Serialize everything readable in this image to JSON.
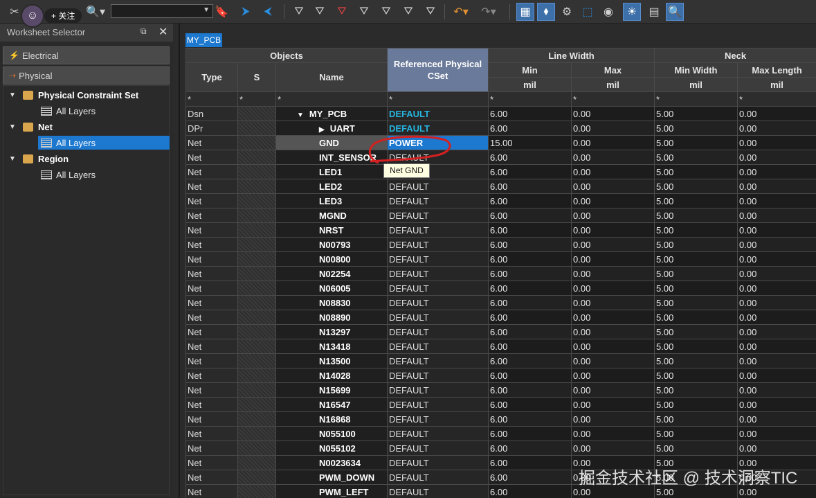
{
  "overlay": {
    "follow_label": "+ 关注",
    "watermark": "掘金技术社区 @ 技术洞察TIC"
  },
  "worksheet_selector": {
    "title": "Worksheet Selector",
    "buttons": [
      "Electrical",
      "Physical"
    ],
    "tree": [
      {
        "label": "Physical Constraint Set",
        "child": "All Layers"
      },
      {
        "label": "Net",
        "child": "All Layers"
      },
      {
        "label": "Region",
        "child": "All Layers"
      }
    ]
  },
  "tab": {
    "label": "MY_PCB"
  },
  "grid": {
    "group_headers": {
      "objects": "Objects",
      "line_width": "Line Width",
      "neck": "Neck"
    },
    "columns": {
      "type": "Type",
      "s": "S",
      "name": "Name",
      "ref": "Referenced Physical CSet",
      "min": "Min",
      "max": "Max",
      "min_width": "Min Width",
      "max_length": "Max Length"
    },
    "unit": "mil",
    "filter": "*",
    "rows": [
      [
        "Dsn",
        "MY_PCB",
        "DEFAULT",
        "6.00",
        "0.00",
        "5.00",
        "0.00"
      ],
      [
        "DPr",
        "UART",
        "DEFAULT",
        "6.00",
        "0.00",
        "5.00",
        "0.00"
      ],
      [
        "Net",
        "GND",
        "POWER",
        "15.00",
        "0.00",
        "5.00",
        "0.00"
      ],
      [
        "Net",
        "INT_SENSOR",
        "DEFAULT",
        "6.00",
        "0.00",
        "5.00",
        "0.00"
      ],
      [
        "Net",
        "LED1",
        "DEFAULT",
        "6.00",
        "0.00",
        "5.00",
        "0.00"
      ],
      [
        "Net",
        "LED2",
        "DEFAULT",
        "6.00",
        "0.00",
        "5.00",
        "0.00"
      ],
      [
        "Net",
        "LED3",
        "DEFAULT",
        "6.00",
        "0.00",
        "5.00",
        "0.00"
      ],
      [
        "Net",
        "MGND",
        "DEFAULT",
        "6.00",
        "0.00",
        "5.00",
        "0.00"
      ],
      [
        "Net",
        "NRST",
        "DEFAULT",
        "6.00",
        "0.00",
        "5.00",
        "0.00"
      ],
      [
        "Net",
        "N00793",
        "DEFAULT",
        "6.00",
        "0.00",
        "5.00",
        "0.00"
      ],
      [
        "Net",
        "N00800",
        "DEFAULT",
        "6.00",
        "0.00",
        "5.00",
        "0.00"
      ],
      [
        "Net",
        "N02254",
        "DEFAULT",
        "6.00",
        "0.00",
        "5.00",
        "0.00"
      ],
      [
        "Net",
        "N06005",
        "DEFAULT",
        "6.00",
        "0.00",
        "5.00",
        "0.00"
      ],
      [
        "Net",
        "N08830",
        "DEFAULT",
        "6.00",
        "0.00",
        "5.00",
        "0.00"
      ],
      [
        "Net",
        "N08890",
        "DEFAULT",
        "6.00",
        "0.00",
        "5.00",
        "0.00"
      ],
      [
        "Net",
        "N13297",
        "DEFAULT",
        "6.00",
        "0.00",
        "5.00",
        "0.00"
      ],
      [
        "Net",
        "N13418",
        "DEFAULT",
        "6.00",
        "0.00",
        "5.00",
        "0.00"
      ],
      [
        "Net",
        "N13500",
        "DEFAULT",
        "6.00",
        "0.00",
        "5.00",
        "0.00"
      ],
      [
        "Net",
        "N14028",
        "DEFAULT",
        "6.00",
        "0.00",
        "5.00",
        "0.00"
      ],
      [
        "Net",
        "N15699",
        "DEFAULT",
        "6.00",
        "0.00",
        "5.00",
        "0.00"
      ],
      [
        "Net",
        "N16547",
        "DEFAULT",
        "6.00",
        "0.00",
        "5.00",
        "0.00"
      ],
      [
        "Net",
        "N16868",
        "DEFAULT",
        "6.00",
        "0.00",
        "5.00",
        "0.00"
      ],
      [
        "Net",
        "N055100",
        "DEFAULT",
        "6.00",
        "0.00",
        "5.00",
        "0.00"
      ],
      [
        "Net",
        "N055102",
        "DEFAULT",
        "6.00",
        "0.00",
        "5.00",
        "0.00"
      ],
      [
        "Net",
        "N0023634",
        "DEFAULT",
        "6.00",
        "0.00",
        "5.00",
        "0.00"
      ],
      [
        "Net",
        "PWM_DOWN",
        "DEFAULT",
        "6.00",
        "0.00",
        "5.00",
        "0.00"
      ],
      [
        "Net",
        "PWM_LEFT",
        "DEFAULT",
        "6.00",
        "0.00",
        "5.00",
        "0.00"
      ]
    ]
  },
  "tooltip": "Net GND",
  "colors": {
    "selection": "#1d78cf",
    "cyan": "#27b5e0",
    "annotation": "#d42020"
  }
}
